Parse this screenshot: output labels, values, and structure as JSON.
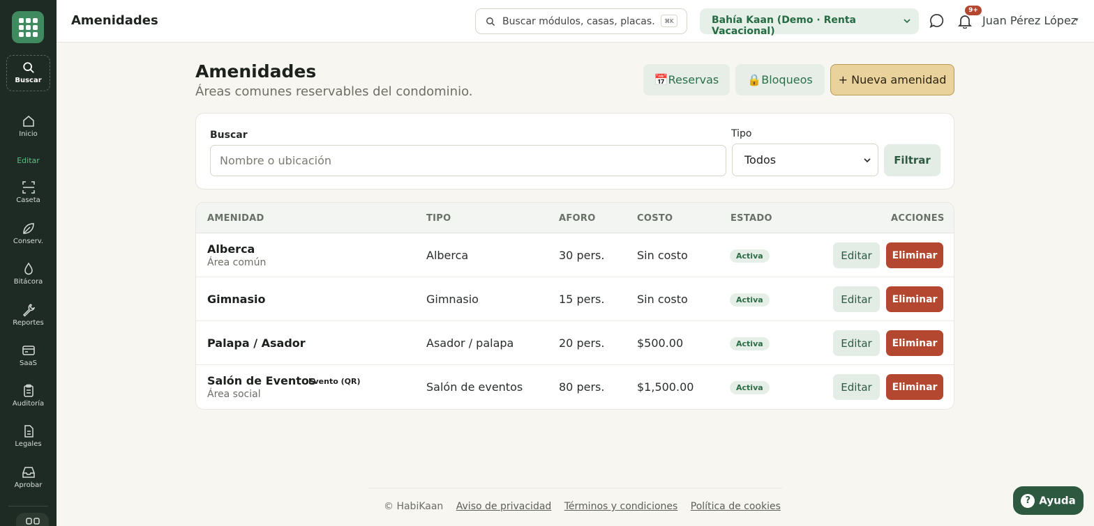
{
  "sidebar": {
    "search_label": "Buscar",
    "items": [
      {
        "label": "Inicio",
        "icon": "home-icon"
      },
      {
        "label": "Caseta",
        "icon": "scan-icon"
      },
      {
        "label": "Conserv.",
        "icon": "leaf-icon"
      },
      {
        "label": "Bitácora",
        "icon": "drop-icon"
      },
      {
        "label": "Reportes",
        "icon": "wrench-icon"
      },
      {
        "label": "SaaS",
        "icon": "card-icon"
      },
      {
        "label": "Auditoría",
        "icon": "clipboard-icon"
      },
      {
        "label": "Legales",
        "icon": "document-icon"
      },
      {
        "label": "Aprobar",
        "icon": "inbox-icon"
      }
    ],
    "section_label": "Editar"
  },
  "topbar": {
    "title": "Amenidades",
    "search_placeholder": "Buscar módulos, casas, placas…",
    "search_shortcut": "⌘K",
    "org": "Bahía Kaan (Demo · Renta Vacacional)",
    "notifications_badge": "9+",
    "user_name": "Juan Pérez López"
  },
  "page": {
    "title": "Amenidades",
    "subtitle": "Áreas comunes reservables del condominio.",
    "btn_reservas": "📅Reservas",
    "btn_bloqueos": "🔒Bloqueos",
    "btn_nueva": "+ Nueva amenidad"
  },
  "filters": {
    "search_label": "Buscar",
    "search_placeholder": "Nombre o ubicación",
    "tipo_label": "Tipo",
    "tipo_value": "Todos",
    "filter_button": "Filtrar"
  },
  "table": {
    "headers": [
      "AMENIDAD",
      "TIPO",
      "AFORO",
      "COSTO",
      "ESTADO",
      "ACCIONES"
    ],
    "rows": [
      {
        "name": "Alberca",
        "sub": "Área común",
        "tag": "",
        "tipo": "Alberca",
        "aforo": "30 pers.",
        "costo": "Sin costo",
        "estado": "Activa",
        "edit": "Editar",
        "delete": "Eliminar"
      },
      {
        "name": "Gimnasio",
        "sub": "",
        "tag": "",
        "tipo": "Gimnasio",
        "aforo": "15 pers.",
        "costo": "Sin costo",
        "estado": "Activa",
        "edit": "Editar",
        "delete": "Eliminar"
      },
      {
        "name": "Palapa / Asador",
        "sub": "",
        "tag": "",
        "tipo": "Asador / palapa",
        "aforo": "20 pers.",
        "costo": "$500.00",
        "estado": "Activa",
        "edit": "Editar",
        "delete": "Eliminar"
      },
      {
        "name": "Salón de Eventos",
        "sub": "Área social",
        "tag": "Evento (QR)",
        "tipo": "Salón de eventos",
        "aforo": "80 pers.",
        "costo": "$1,500.00",
        "estado": "Activa",
        "edit": "Editar",
        "delete": "Eliminar"
      }
    ]
  },
  "footer": {
    "copyright": "© HabiKaan",
    "links": [
      "Aviso de privacidad",
      "Términos y condiciones",
      "Política de cookies"
    ]
  },
  "help_button": "Ayuda",
  "colors": {
    "sidebar_bg": "#1e2b24",
    "accent_green": "#3f8a5f",
    "danger": "#b4472f",
    "primary_gold": "#e9d29b"
  }
}
